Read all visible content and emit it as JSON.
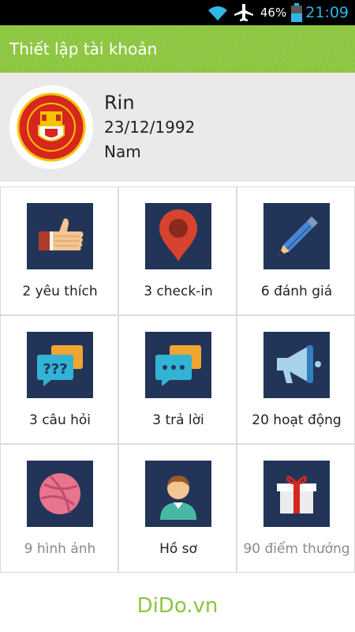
{
  "status_bar": {
    "battery_percent": "46%",
    "time": "21:09",
    "icons": [
      "wifi-icon",
      "airplane-mode-icon",
      "battery-icon"
    ]
  },
  "action_bar": {
    "title": "Thiết lập tài khoản",
    "color": "#8cc63f"
  },
  "profile": {
    "name": "Rin",
    "birthday": "23/12/1992",
    "gender": "Nam",
    "avatar_icon": "manchester-united-crest"
  },
  "tiles": [
    {
      "label": "2 yêu thích",
      "icon": "thumbs-up-icon",
      "muted": false
    },
    {
      "label": "3 check-in",
      "icon": "map-pin-icon",
      "muted": false
    },
    {
      "label": "6 đánh giá",
      "icon": "pencil-icon",
      "muted": false
    },
    {
      "label": "3 câu hỏi",
      "icon": "question-bubbles-icon",
      "muted": false
    },
    {
      "label": "3 trả lời",
      "icon": "reply-bubbles-icon",
      "muted": false
    },
    {
      "label": "20 hoạt động",
      "icon": "megaphone-icon",
      "muted": false
    },
    {
      "label": "9 hình ảnh",
      "icon": "dribbble-ball-icon",
      "muted": true
    },
    {
      "label": "Hồ sơ",
      "icon": "user-profile-icon",
      "muted": false
    },
    {
      "label": "90 điểm thưởng",
      "icon": "gift-icon",
      "muted": true
    }
  ],
  "footer": {
    "brand": "DiDo.vn"
  },
  "colors": {
    "accent": "#8cc63f",
    "tile_icon_bg": "#223558",
    "clock": "#33b5e5"
  }
}
